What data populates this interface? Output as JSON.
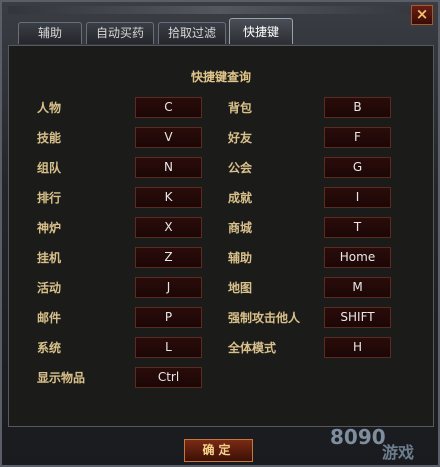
{
  "window": {
    "close_label": "×"
  },
  "tabs": [
    {
      "label": "辅助"
    },
    {
      "label": "自动买药"
    },
    {
      "label": "拾取过滤"
    },
    {
      "label": "快捷键",
      "active": true
    }
  ],
  "panel": {
    "title": "快捷键查询"
  },
  "shortcuts_left": [
    {
      "label": "人物",
      "key": "C"
    },
    {
      "label": "技能",
      "key": "V"
    },
    {
      "label": "组队",
      "key": "N"
    },
    {
      "label": "排行",
      "key": "K"
    },
    {
      "label": "神炉",
      "key": "X"
    },
    {
      "label": "挂机",
      "key": "Z"
    },
    {
      "label": "活动",
      "key": "J"
    },
    {
      "label": "邮件",
      "key": "P"
    },
    {
      "label": "系统",
      "key": "L"
    },
    {
      "label": "显示物品",
      "key": "Ctrl"
    }
  ],
  "shortcuts_right": [
    {
      "label": "背包",
      "key": "B"
    },
    {
      "label": "好友",
      "key": "F"
    },
    {
      "label": "公会",
      "key": "G"
    },
    {
      "label": "成就",
      "key": "I"
    },
    {
      "label": "商城",
      "key": "T"
    },
    {
      "label": "辅助",
      "key": "Home"
    },
    {
      "label": "地图",
      "key": "M"
    },
    {
      "label": "强制攻击他人",
      "key": "SHIFT"
    },
    {
      "label": "全体模式",
      "key": "H"
    }
  ],
  "footer": {
    "ok_label": "确定"
  },
  "watermark": {
    "text": "8090",
    "sub": "游戏"
  }
}
